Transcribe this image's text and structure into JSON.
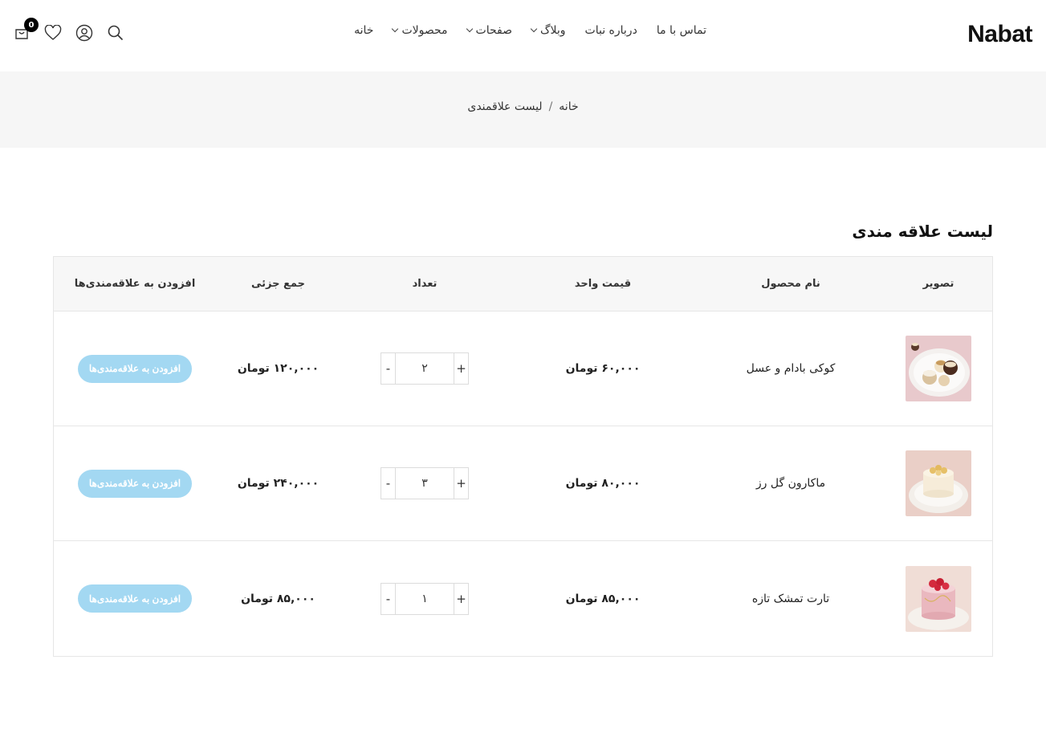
{
  "brand": {
    "logo": "Nabat"
  },
  "nav": {
    "items": [
      {
        "label": "خانه",
        "dropdown": false
      },
      {
        "label": "محصولات",
        "dropdown": true
      },
      {
        "label": "صفحات",
        "dropdown": true
      },
      {
        "label": "وبلاگ",
        "dropdown": true
      },
      {
        "label": "درباره نبات",
        "dropdown": false
      },
      {
        "label": "تماس با ما",
        "dropdown": false
      }
    ]
  },
  "header_icons": {
    "icons": [
      "search-icon",
      "user-icon",
      "heart-icon",
      "cart-icon"
    ],
    "cart_count": "0"
  },
  "breadcrumb": {
    "home": "خانه",
    "separator": "/",
    "current": "لیست علاقمندی"
  },
  "page": {
    "title": "لیست علاقه مندی"
  },
  "table": {
    "headers": {
      "image": "تصویر",
      "name": "نام محصول",
      "unit_price": "قیمت واحد",
      "quantity": "تعداد",
      "subtotal": "جمع جزئی",
      "action": "افزودن به علاقه‌مندی‌ها"
    },
    "rows": [
      {
        "name": "کوکی بادام و عسل",
        "unit_price": "۶۰,۰۰۰ تومان",
        "quantity": "۲",
        "subtotal": "۱۲۰,۰۰۰ تومان",
        "action": "افزودن به علاقه‌مندی‌ها"
      },
      {
        "name": "ماکارون گل رز",
        "unit_price": "۸۰,۰۰۰ تومان",
        "quantity": "۳",
        "subtotal": "۲۴۰,۰۰۰ تومان",
        "action": "افزودن به علاقه‌مندی‌ها"
      },
      {
        "name": "تارت تمشک تازه",
        "unit_price": "۸۵,۰۰۰ تومان",
        "quantity": "۱",
        "subtotal": "۸۵,۰۰۰ تومان",
        "action": "افزودن به علاقه‌مندی‌ها"
      }
    ],
    "qty_minus": "-",
    "qty_plus": "+"
  },
  "colors": {
    "accent_button": "#a3d8f2",
    "band": "#f6f6f6",
    "badge": "#000000"
  }
}
